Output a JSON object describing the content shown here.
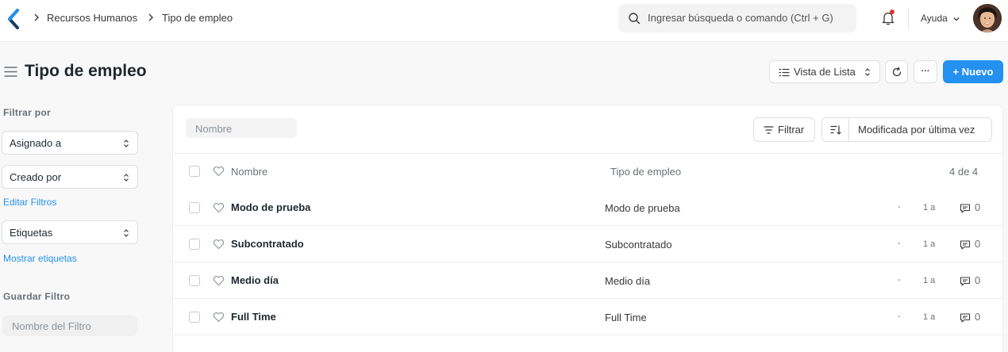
{
  "breadcrumbs": [
    "Recursos Humanos",
    "Tipo de empleo"
  ],
  "search": {
    "placeholder": "Ingresar búsqueda o comando (Ctrl + G)"
  },
  "header": {
    "help_label": "Ayuda"
  },
  "page": {
    "title": "Tipo de empleo",
    "view_label": "Vista de Lista",
    "more_label": "···",
    "new_label": "+ Nuevo"
  },
  "sidebar": {
    "filter_by_label": "Filtrar por",
    "assigned_to": "Asignado a",
    "created_by": "Creado por",
    "edit_filters": "Editar Filtros",
    "tags": "Etiquetas",
    "show_tags": "Mostrar etiquetas",
    "save_filter_label": "Guardar Filtro",
    "filter_name_placeholder": "Nombre del Filtro"
  },
  "list": {
    "name_placeholder": "Nombre",
    "filter_label": "Filtrar",
    "sort_label": "Modificada por última vez",
    "columns": {
      "name": "Nombre",
      "type": "Tipo de empleo"
    },
    "count": "4 de 4",
    "rows": [
      {
        "name": "Modo de prueba",
        "type": "Modo de prueba",
        "dash": "-",
        "age": "1 a",
        "comments": "0"
      },
      {
        "name": "Subcontratado",
        "type": "Subcontratado",
        "dash": "-",
        "age": "1 a",
        "comments": "0"
      },
      {
        "name": "Medio día",
        "type": "Medio día",
        "dash": "-",
        "age": "1 a",
        "comments": "0"
      },
      {
        "name": "Full Time",
        "type": "Full Time",
        "dash": "-",
        "age": "1 a",
        "comments": "0"
      }
    ]
  },
  "colors": {
    "accent": "#2490ef",
    "notification": "#e03636"
  }
}
